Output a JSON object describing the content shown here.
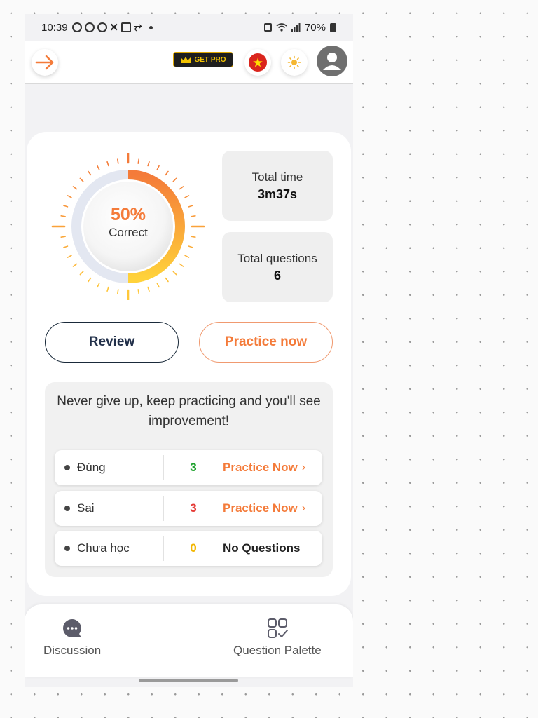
{
  "status_bar": {
    "time": "10:39",
    "battery": "70%"
  },
  "header": {
    "getpro_label": "GET PRO"
  },
  "result": {
    "percent": "50%",
    "correct_label": "Correct",
    "correct_fraction": 0.5,
    "total_time_label": "Total time",
    "total_time_value": "3m37s",
    "total_questions_label": "Total questions",
    "total_questions_value": "6"
  },
  "buttons": {
    "review": "Review",
    "practice_now": "Practice now"
  },
  "tip": {
    "text": "Never give up, keep practicing and you'll see improvement!"
  },
  "rows": [
    {
      "name": "Đúng",
      "count": "3",
      "count_color": "#1fa22e",
      "action": "Practice Now",
      "action_style": "orange"
    },
    {
      "name": "Sai",
      "count": "3",
      "count_color": "#e53935",
      "action": "Practice Now",
      "action_style": "orange"
    },
    {
      "name": "Chưa học",
      "count": "0",
      "count_color": "#f2b600",
      "action": "No Questions",
      "action_style": "dark"
    }
  ],
  "bottom_nav": {
    "discussion": "Discussion",
    "question_palette": "Question Palette"
  },
  "colors": {
    "accent": "#f47b3a",
    "ring_track": "#e3e7f1",
    "ring_gradient_end": "#ffd23a"
  },
  "icons": [
    "arrow-right-icon",
    "crown-icon",
    "vietnam-flag-icon",
    "sun-icon",
    "user-icon",
    "chat-bubble-icon",
    "grid-check-icon"
  ]
}
